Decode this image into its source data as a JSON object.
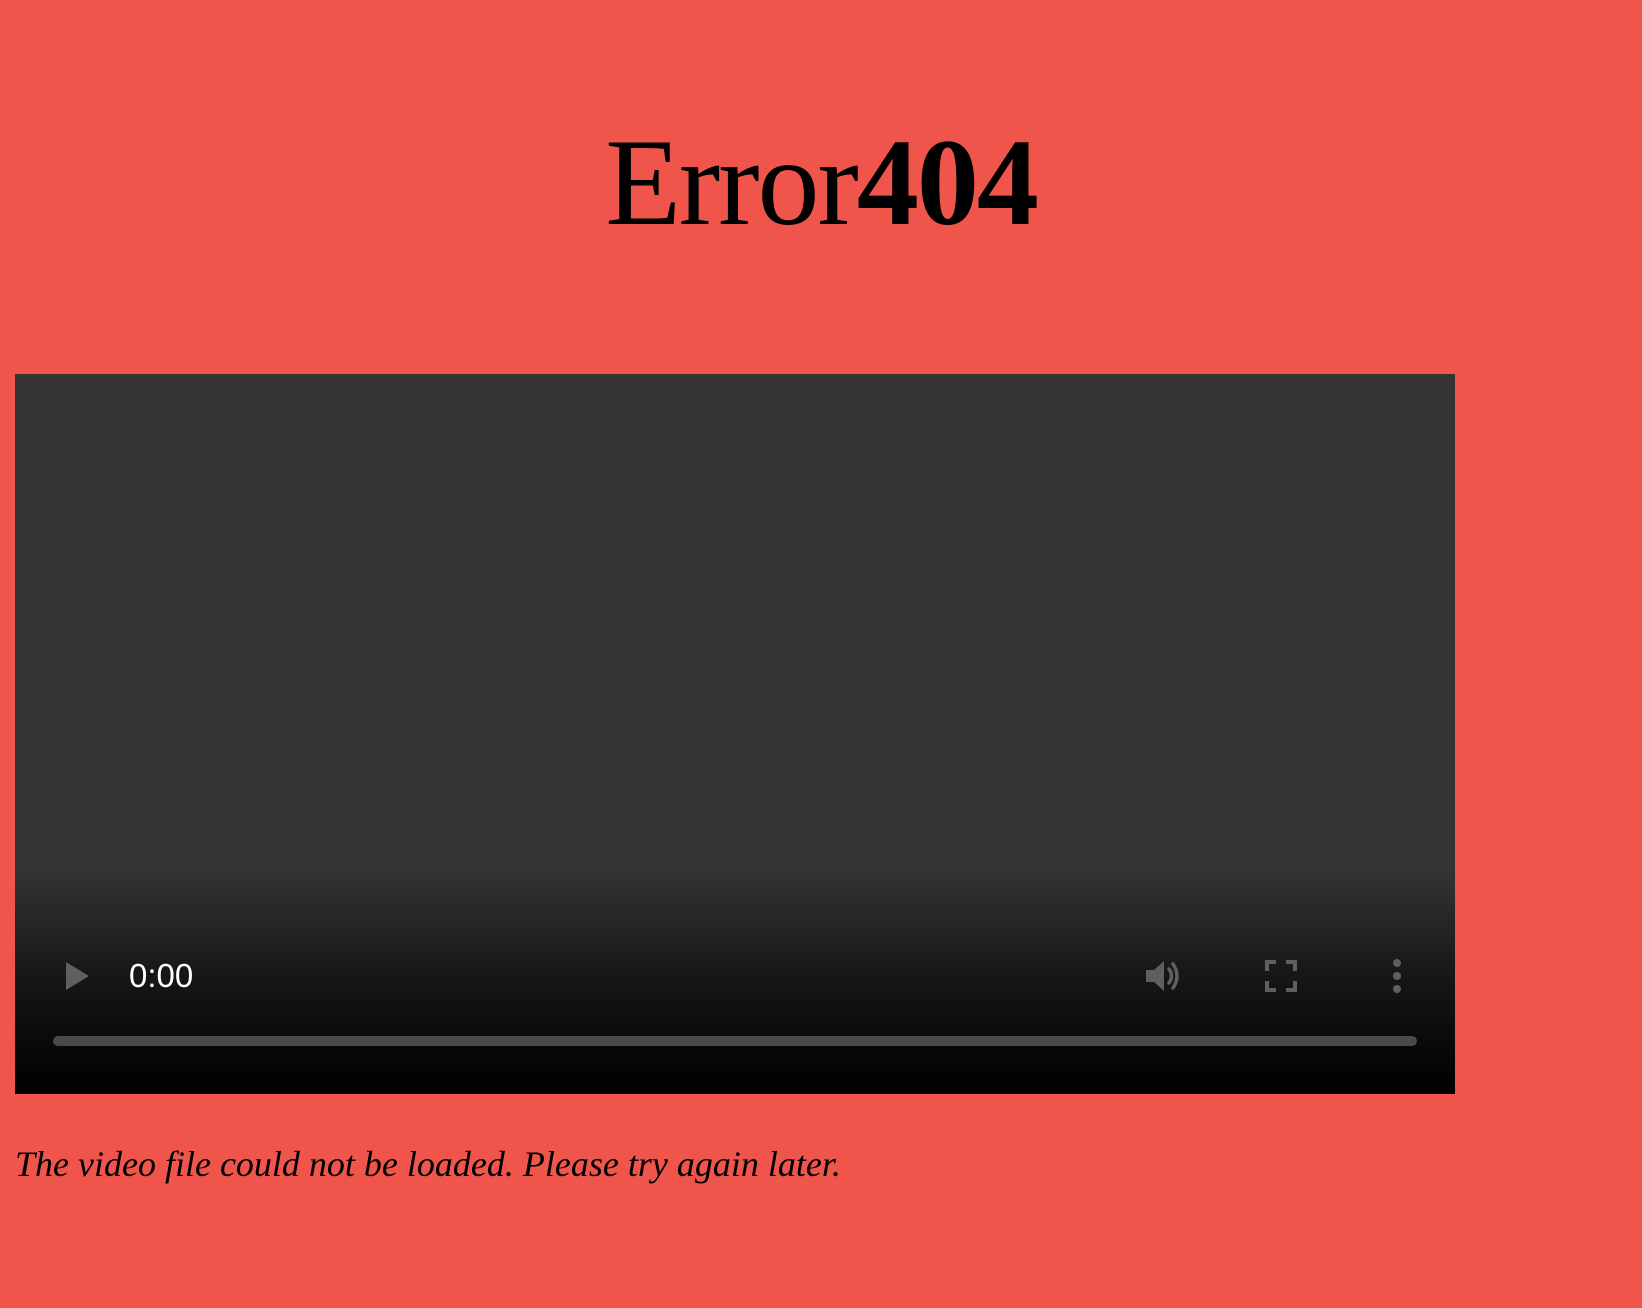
{
  "heading": {
    "word": "Error",
    "code": "404"
  },
  "video_player": {
    "current_time": "0:00",
    "progress": 0,
    "icons": {
      "play": "play-icon",
      "volume": "volume-icon",
      "fullscreen": "fullscreen-icon",
      "more": "more-options-icon"
    }
  },
  "message": "The video file could not be loaded. Please try again later.",
  "colors": {
    "background": "#ef554b",
    "video_background": "#333333",
    "icon_color": "#5f5f5f"
  }
}
